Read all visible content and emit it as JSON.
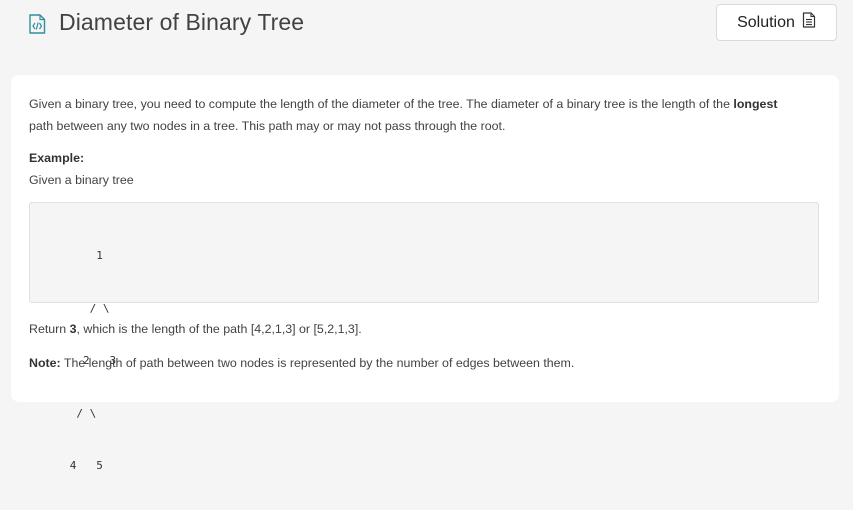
{
  "header": {
    "title": "Diameter of Binary Tree",
    "icon": "code-file-icon",
    "solution_label": "Solution",
    "solution_icon": "document-icon"
  },
  "problem": {
    "desc_line1_pre": "Given a binary tree, you need to compute the length of the diameter of the tree. The diameter of a binary tree is the length of the ",
    "desc_line1_bold": "longest",
    "desc_line2": "path between any two nodes in a tree. This path may or may not pass through the root.",
    "example_label": "Example:",
    "example_intro": "Given a binary tree",
    "tree_lines": [
      "          1",
      "         / \\",
      "        2   3",
      "       / \\",
      "      4   5"
    ],
    "return_pre": "Return ",
    "return_bold": "3",
    "return_post": ", which is the length of the path [4,2,1,3] or [5,2,1,3].",
    "note_label": "Note:",
    "note_text": " The length of path between two nodes is represented by the number of edges between them."
  },
  "colors": {
    "page_bg": "#f5f5f5",
    "card_bg": "#ffffff",
    "icon_teal": "#2f8f9d"
  }
}
